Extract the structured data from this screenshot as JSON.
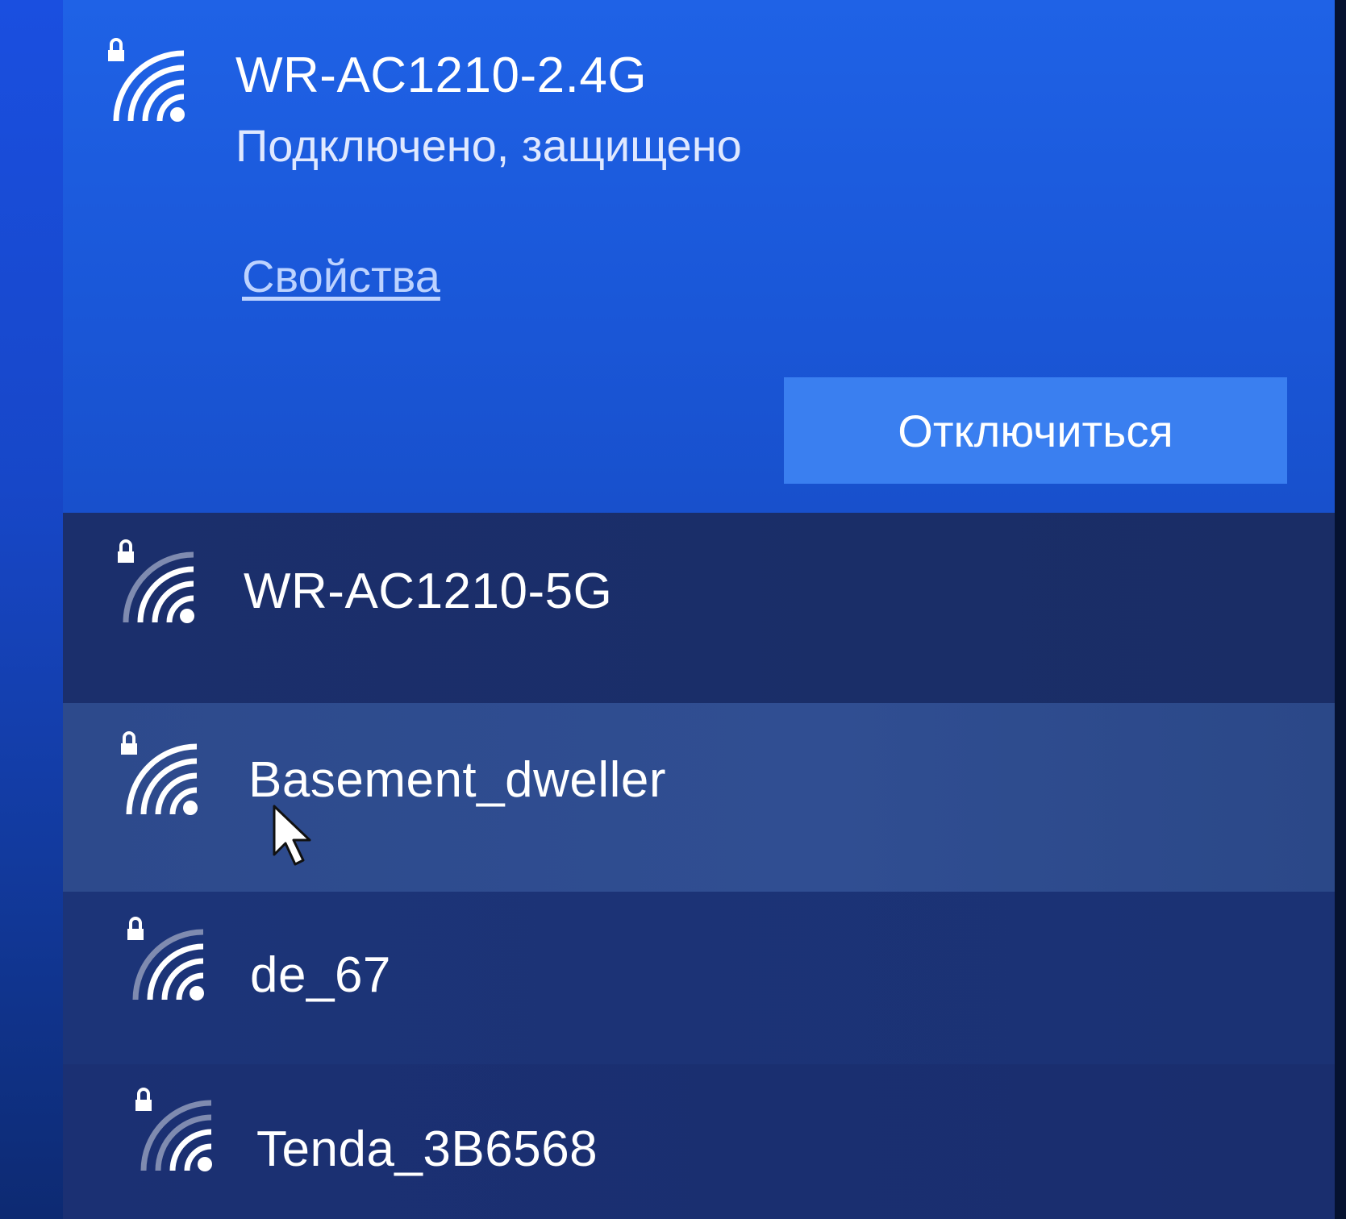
{
  "colors": {
    "accent": "#1f62e6",
    "button": "#3a7ff0",
    "link": "#bcd2ff"
  },
  "connected": {
    "ssid": "WR-AC1210-2.4G",
    "status": "Подключено, защищено",
    "properties_link": "Свойства",
    "disconnect_label": "Отключиться",
    "icon": "wifi-secured-icon"
  },
  "networks": [
    {
      "ssid": "WR-AC1210-5G",
      "icon": "wifi-secured-icon"
    },
    {
      "ssid": "Basement_dweller",
      "icon": "wifi-secured-icon"
    },
    {
      "ssid": "de_67",
      "icon": "wifi-secured-icon"
    },
    {
      "ssid": "Tenda_3B6568",
      "icon": "wifi-secured-icon"
    }
  ],
  "pointer": {
    "icon": "mouse-cursor-icon"
  }
}
